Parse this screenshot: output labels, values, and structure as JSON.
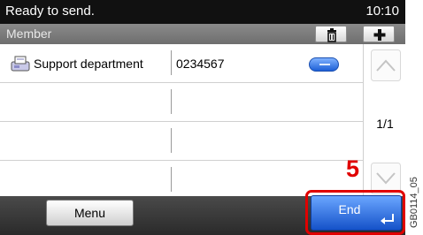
{
  "status": {
    "text": "Ready to send.",
    "time": "10:10"
  },
  "header": {
    "title": "Member"
  },
  "members": [
    {
      "name": "Support department",
      "number": "0234567",
      "has_detail": true
    },
    {
      "name": "",
      "number": "",
      "has_detail": false
    },
    {
      "name": "",
      "number": "",
      "has_detail": false
    },
    {
      "name": "",
      "number": "",
      "has_detail": false
    }
  ],
  "pagination": {
    "indicator": "1/1"
  },
  "footer": {
    "menu_label": "Menu",
    "end_label": "End"
  },
  "annotation": {
    "step": "5",
    "image_code": "GB0114_05"
  },
  "colors": {
    "accent_blue": "#1552c9",
    "highlight_red": "#e00000",
    "statusbar": "#111111"
  },
  "icons": [
    "trash-icon",
    "plus-icon",
    "fax-icon",
    "detail-icon",
    "arrow-up-icon",
    "arrow-down-icon",
    "enter-icon"
  ]
}
